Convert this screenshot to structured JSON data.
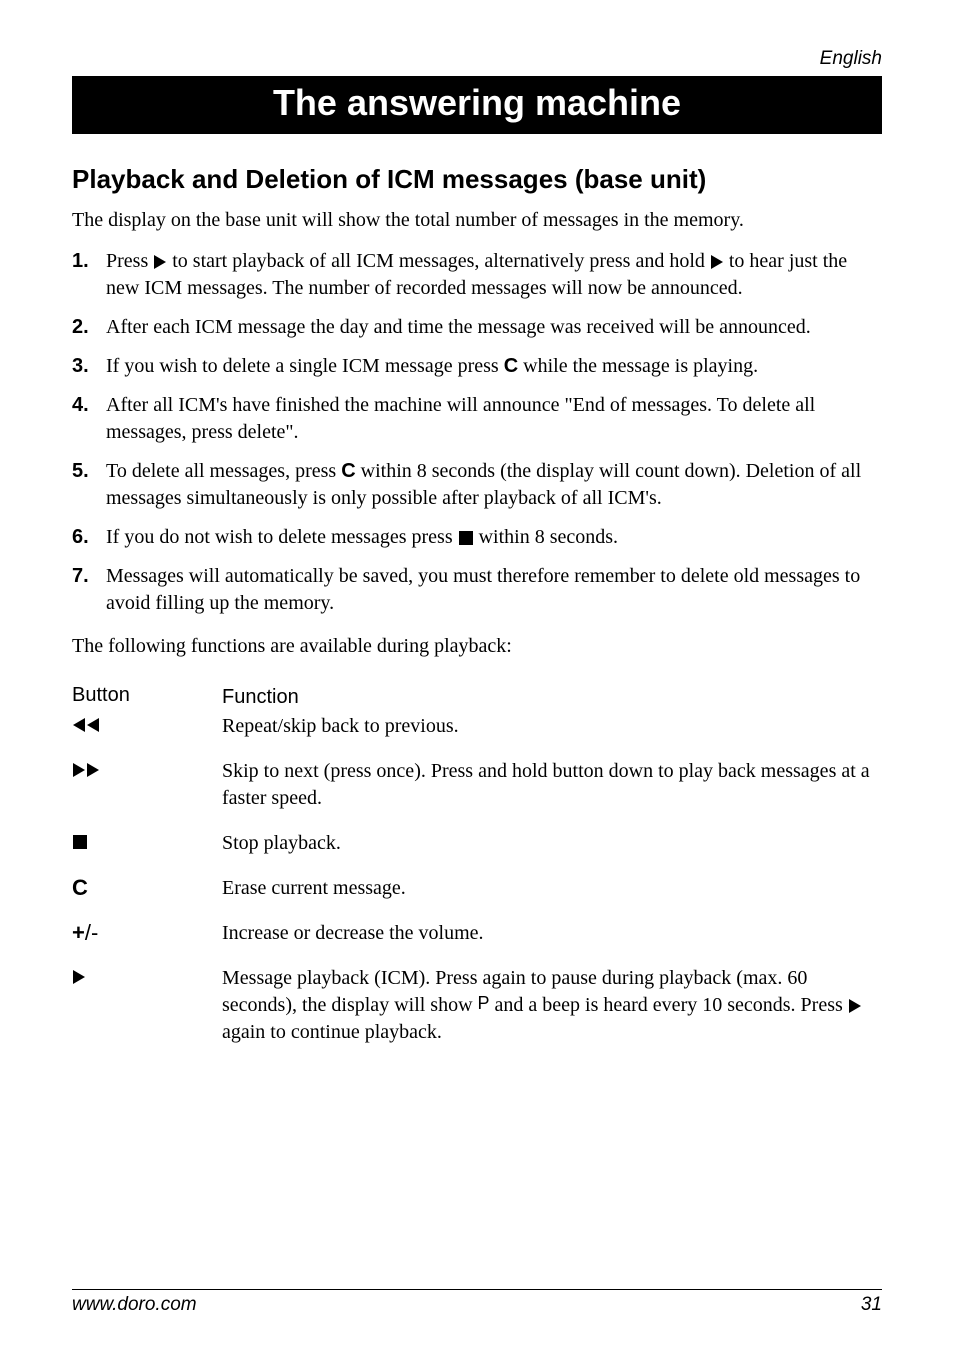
{
  "lang_label": "English",
  "title_bar": "The answering machine",
  "section_heading": "Playback and Deletion of ICM messages (base unit)",
  "intro": "The display on the base unit will show the total number of messages in the memory.",
  "steps": {
    "s1a": "Press ",
    "s1b": " to start playback of all ICM messages, alternatively press and hold ",
    "s1c": " to hear just the new ICM messages. The number of recorded messages will now be announced.",
    "s2": "After each ICM message the day and time the message was received will be announced.",
    "s3a": "If you wish to delete a single ICM message press ",
    "s3c": "C",
    "s3b": " while the message is playing.",
    "s4": "After all ICM's have finished the machine will announce \"End of messages. To delete all messages, press delete\".",
    "s5a": "To delete all messages, press ",
    "s5c": "C",
    "s5b": " within 8 seconds (the display will count down). Deletion of all messages simultaneously is only possible after playback of all ICM's.",
    "s6a": "If you do not wish to delete messages press ",
    "s6b": " within 8 seconds.",
    "s7": "Messages will automatically be saved, you must therefore remember to delete old messages to avoid filling up the memory."
  },
  "avail_line": "The following functions are available during playback:",
  "table": {
    "header_button": "Button",
    "header_function": "Function",
    "row1_desc": "Repeat/skip back to previous.",
    "row2_desc": "Skip to next (press once). Press and hold button down to play back messages at a faster speed.",
    "row3_desc": "Stop playback.",
    "row4_btn": "C",
    "row4_desc": "Erase current message.",
    "row5_btn_plus": "+",
    "row5_btn_slash": "/",
    "row5_btn_minus": "-",
    "row5_desc": "Increase or decrease the volume.",
    "row6a": "Message playback (ICM). Press again to pause during playback (max. 60 seconds), the display will show ",
    "row6p": "P",
    "row6b": " and a beep is heard every 10 seconds. Press ",
    "row6c": " again to continue playback."
  },
  "footer_left": "www.doro.com",
  "footer_right": "31"
}
